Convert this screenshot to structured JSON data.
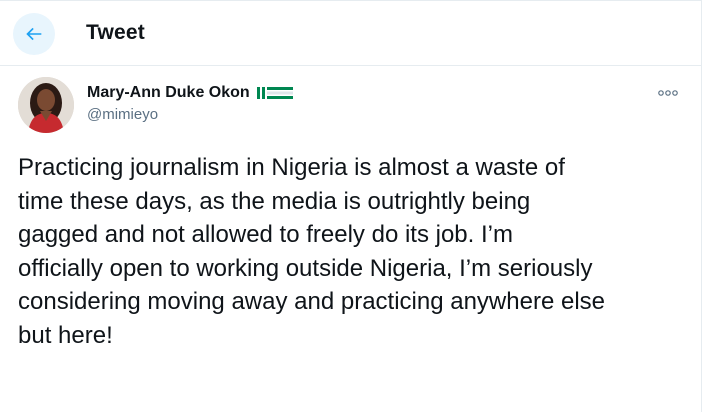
{
  "header": {
    "back_icon": "arrow-left-icon",
    "title": "Tweet"
  },
  "author": {
    "display_name": "Mary-Ann Duke Okon",
    "flag_icon": "nigeria-flag-icon",
    "handle": "@mimieyo"
  },
  "tweet": {
    "lines": [
      "Practicing journalism in Nigeria is almost a waste of",
      "time these days, as the media is outrightly being",
      "gagged and not allowed to freely do its job. I’m",
      "officially open to working outside Nigeria, I’m seriously",
      "considering moving away and practicing anywhere else",
      "but here!"
    ]
  },
  "colors": {
    "accent": "#1da1f2",
    "accent_bg": "#e8f5fd",
    "text": "#0f1419",
    "secondary_text": "#5b7083",
    "flag_green": "#008751",
    "flag_white": "#ffffff"
  }
}
